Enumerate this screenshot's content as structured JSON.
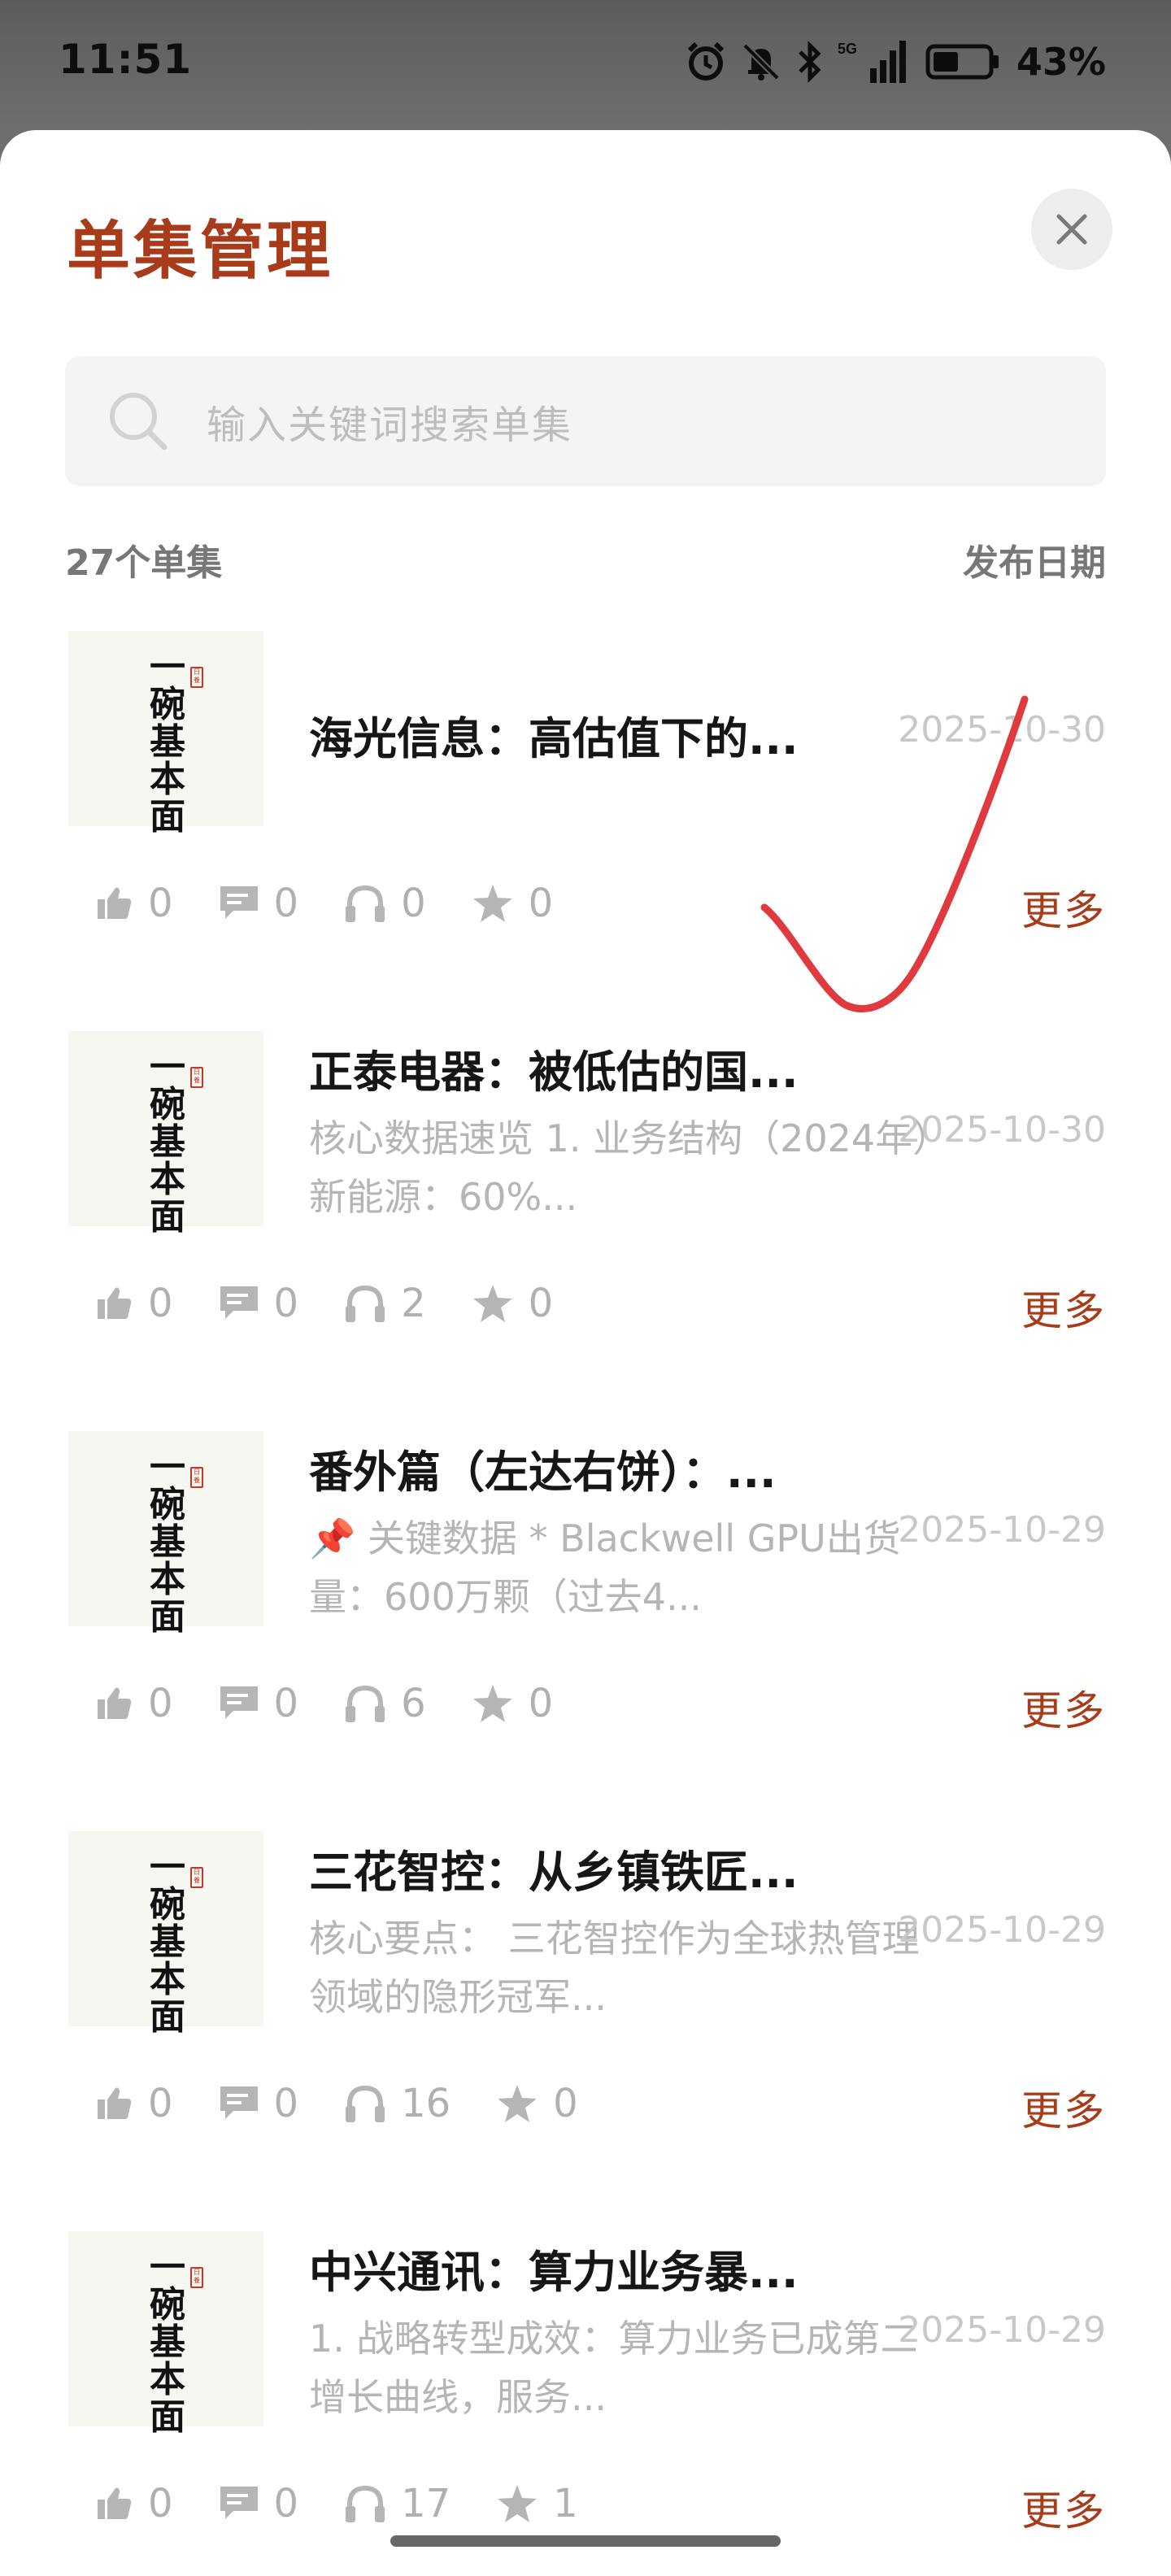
{
  "status_bar": {
    "time": "11:51",
    "network": "5G",
    "battery_pct": "43%",
    "icons": [
      "alarm-icon",
      "mute-icon",
      "bluetooth-icon",
      "signal-icon",
      "battery-icon"
    ]
  },
  "sheet": {
    "title": "单集管理",
    "close_icon": "close-icon",
    "search_placeholder": "输入关键词搜索单集",
    "count_label": "27个单集",
    "sort_label": "发布日期",
    "accent_color": "#a83c1a"
  },
  "cover": {
    "text": "一碗基本面",
    "seal": "日養"
  },
  "episodes": [
    {
      "title": "海光信息：高估值下的...",
      "description": "",
      "date": "2025-10-30",
      "likes": "0",
      "comments": "0",
      "listens": "0",
      "stars": "0",
      "more": "更多"
    },
    {
      "title": "正泰电器：被低估的国...",
      "description": "核心数据速览 1. 业务结构（2024年）新能源：60%...",
      "date": "2025-10-30",
      "likes": "0",
      "comments": "0",
      "listens": "2",
      "stars": "0",
      "more": "更多"
    },
    {
      "title": "番外篇（左达右饼）：...",
      "description": "📌 关键数据 * Blackwell GPU出货量：600万颗（过去4...",
      "date": "2025-10-29",
      "likes": "0",
      "comments": "0",
      "listens": "6",
      "stars": "0",
      "more": "更多"
    },
    {
      "title": "三花智控：从乡镇铁匠...",
      "description": "核心要点： 三花智控作为全球热管理领域的隐形冠军...",
      "date": "2025-10-29",
      "likes": "0",
      "comments": "0",
      "listens": "16",
      "stars": "0",
      "more": "更多"
    },
    {
      "title": "中兴通讯：算力业务暴...",
      "description": "1. 战略转型成效：算力业务已成第二增长曲线，服务...",
      "date": "2025-10-29",
      "likes": "0",
      "comments": "0",
      "listens": "17",
      "stars": "1",
      "more": "更多"
    }
  ]
}
